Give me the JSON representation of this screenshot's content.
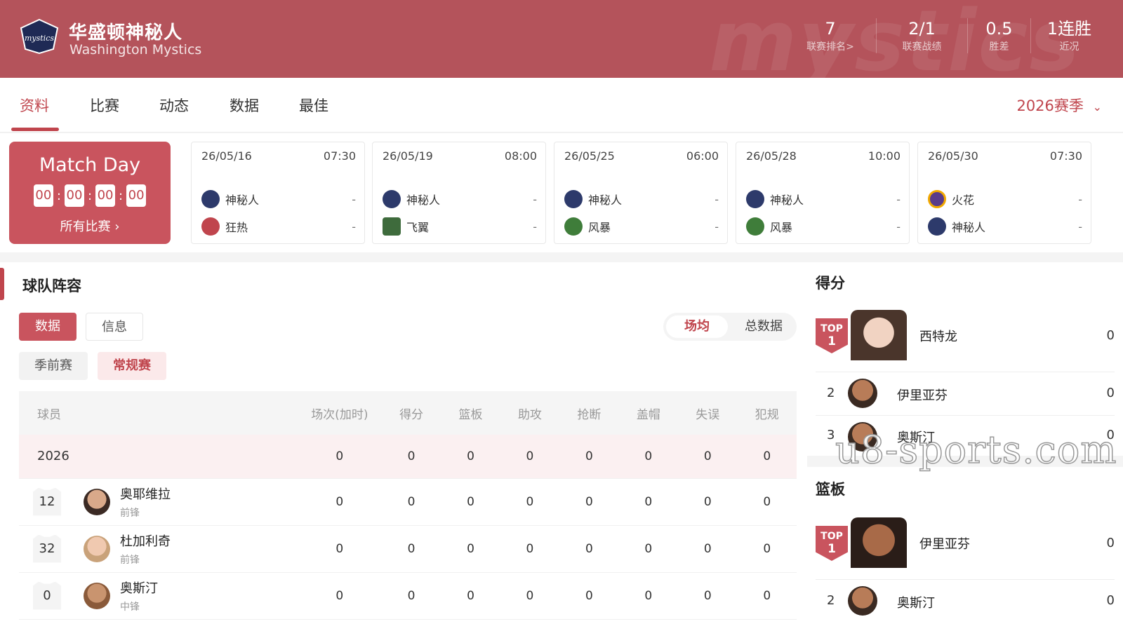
{
  "header": {
    "team_cn": "华盛顿神秘人",
    "team_en": "Washington Mystics",
    "logo_text": "mystics",
    "bg_word": "mystics",
    "stats": [
      {
        "value": "7",
        "label": "联赛排名>"
      },
      {
        "value": "2/1",
        "label": "联赛战绩"
      },
      {
        "value": "0.5",
        "label": "胜差"
      },
      {
        "value": "1连胜",
        "label": "近况"
      }
    ]
  },
  "tabs": [
    "资料",
    "比赛",
    "动态",
    "数据",
    "最佳"
  ],
  "active_tab": "资料",
  "season": "2026赛季",
  "matchday": {
    "title": "Match Day",
    "countdown": [
      "00",
      "00",
      "00",
      "00"
    ],
    "all_link": "所有比赛 ›"
  },
  "matches": [
    {
      "date": "26/05/16",
      "time": "07:30",
      "home": {
        "name": "神秘人",
        "score": "-",
        "color": "#2d3a6b"
      },
      "away": {
        "name": "狂热",
        "score": "-",
        "color": "#c0454d"
      }
    },
    {
      "date": "26/05/19",
      "time": "08:00",
      "home": {
        "name": "神秘人",
        "score": "-",
        "color": "#2d3a6b"
      },
      "away": {
        "name": "飞翼",
        "score": "-",
        "color": "#3e6b3c"
      }
    },
    {
      "date": "26/05/25",
      "time": "06:00",
      "home": {
        "name": "神秘人",
        "score": "-",
        "color": "#2d3a6b"
      },
      "away": {
        "name": "风暴",
        "score": "-",
        "color": "#3f7d3a"
      }
    },
    {
      "date": "26/05/28",
      "time": "10:00",
      "home": {
        "name": "神秘人",
        "score": "-",
        "color": "#2d3a6b"
      },
      "away": {
        "name": "风暴",
        "score": "-",
        "color": "#3f7d3a"
      }
    },
    {
      "date": "26/05/30",
      "time": "07:30",
      "home": {
        "name": "火花",
        "score": "-",
        "color": "#5a3c8a"
      },
      "away": {
        "name": "神秘人",
        "score": "-",
        "color": "#2d3a6b"
      }
    }
  ],
  "roster": {
    "title": "球队阵容",
    "btn_data": "数据",
    "btn_info": "信息",
    "seg_avg": "场均",
    "seg_total": "总数据",
    "btn_preseason": "季前赛",
    "btn_regular": "常规赛",
    "columns": [
      "球员",
      "场次(加时)",
      "得分",
      "篮板",
      "助攻",
      "抢断",
      "盖帽",
      "失误",
      "犯规"
    ],
    "season_row": {
      "label": "2026",
      "values": [
        "0",
        "0",
        "0",
        "0",
        "0",
        "0",
        "0",
        "0"
      ]
    },
    "players": [
      {
        "number": "12",
        "name": "奥耶维拉",
        "position": "前锋",
        "values": [
          "0",
          "0",
          "0",
          "0",
          "0",
          "0",
          "0",
          "0"
        ]
      },
      {
        "number": "32",
        "name": "杜加利奇",
        "position": "前锋",
        "values": [
          "0",
          "0",
          "0",
          "0",
          "0",
          "0",
          "0",
          "0"
        ]
      },
      {
        "number": "0",
        "name": "奥斯汀",
        "position": "中锋",
        "values": [
          "0",
          "0",
          "0",
          "0",
          "0",
          "0",
          "0",
          "0"
        ]
      }
    ]
  },
  "leaders": {
    "points": {
      "title": "得分",
      "top": {
        "badge": "TOP",
        "rank": "1",
        "name": "西特龙",
        "value": "0"
      },
      "others": [
        {
          "rank": "2",
          "name": "伊里亚芬",
          "value": "0"
        },
        {
          "rank": "3",
          "name": "奥斯汀",
          "value": "0"
        }
      ]
    },
    "rebounds": {
      "title": "篮板",
      "top": {
        "badge": "TOP",
        "rank": "1",
        "name": "伊里亚芬",
        "value": "0"
      },
      "others": [
        {
          "rank": "2",
          "name": "奥斯汀",
          "value": "0"
        }
      ]
    }
  },
  "watermark": "u8-sports.com",
  "colors": {
    "brand": "#b4535b",
    "accent": "#c0454d"
  }
}
